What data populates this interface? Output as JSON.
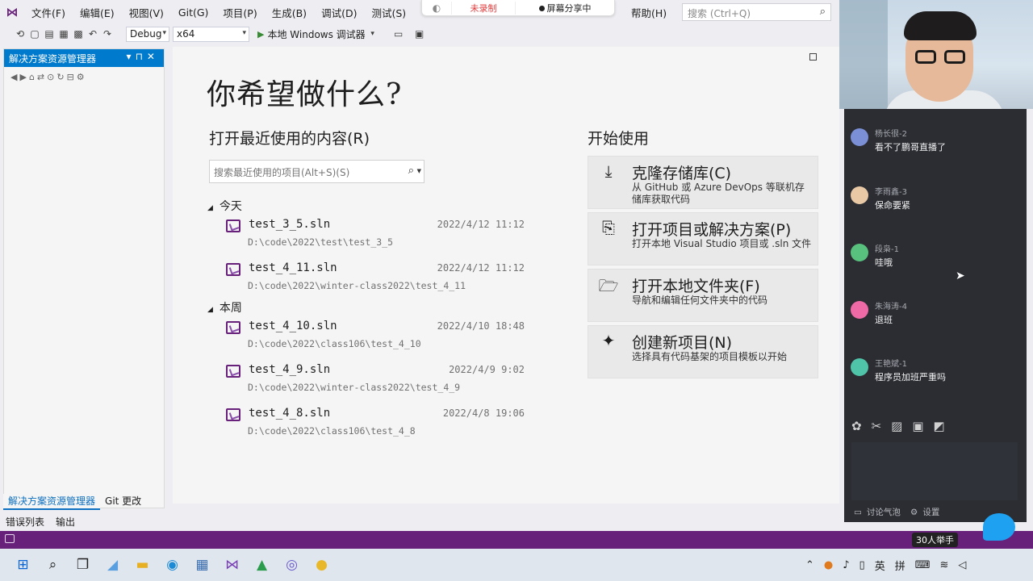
{
  "menu": {
    "items": [
      "文件(F)",
      "编辑(E)",
      "视图(V)",
      "Git(G)",
      "项目(P)",
      "生成(B)",
      "调试(D)",
      "测试(S)"
    ],
    "help": "帮助(H)",
    "search_placeholder": "搜索 (Ctrl+Q)"
  },
  "recording": {
    "unrecorded": "未录制",
    "sharing": "屏幕分享中"
  },
  "toolbar": {
    "config": "Debug",
    "platform": "x64",
    "run_target": "本地 Windows 调试器"
  },
  "solution_explorer": {
    "title": "解决方案资源管理器",
    "tabs": [
      "解决方案资源管理器",
      "Git 更改"
    ]
  },
  "bottom_tabs": [
    "错误列表",
    "输出"
  ],
  "start_page": {
    "title": "你希望做什么?",
    "recent_heading": "打开最近使用的内容(R)",
    "recent_search_placeholder": "搜索最近使用的项目(Alt+S)(S)",
    "groups": [
      {
        "label": "今天",
        "items": [
          {
            "name": "test_3_5.sln",
            "date": "2022/4/12 11:12",
            "path": "D:\\code\\2022\\test\\test_3_5"
          },
          {
            "name": "test_4_11.sln",
            "date": "2022/4/12 11:12",
            "path": "D:\\code\\2022\\winter-class2022\\test_4_11"
          }
        ]
      },
      {
        "label": "本周",
        "items": [
          {
            "name": "test_4_10.sln",
            "date": "2022/4/10 18:48",
            "path": "D:\\code\\2022\\class106\\test_4_10"
          },
          {
            "name": "test_4_9.sln",
            "date": "2022/4/9 9:02",
            "path": "D:\\code\\2022\\winter-class2022\\test_4_9"
          },
          {
            "name": "test_4_8.sln",
            "date": "2022/4/8 19:06",
            "path": "D:\\code\\2022\\class106\\test_4_8"
          }
        ]
      }
    ],
    "get_started_heading": "开始使用",
    "cards": [
      {
        "title": "克隆存储库(C)",
        "desc": "从 GitHub 或 Azure DevOps 等联机存储库获取代码",
        "icon": "clone-icon"
      },
      {
        "title": "打开项目或解决方案(P)",
        "desc": "打开本地 Visual Studio 项目或 .sln 文件",
        "icon": "open-project-icon"
      },
      {
        "title": "打开本地文件夹(F)",
        "desc": "导航和编辑任何文件夹中的代码",
        "icon": "open-folder-icon"
      },
      {
        "title": "创建新项目(N)",
        "desc": "选择具有代码基架的项目模板以开始",
        "icon": "new-project-icon"
      }
    ]
  },
  "chat": {
    "messages": [
      {
        "user": "杨长很-2",
        "text": "看不了鹏哥直播了",
        "color": "#7b8fd6"
      },
      {
        "user": "李雨鑫-3",
        "text": "保命要紧",
        "color": "#e9c9a5"
      },
      {
        "user": "段枭-1",
        "text": "哇哦",
        "color": "#59c17e"
      },
      {
        "user": "朱海涛-4",
        "text": "退班",
        "color": "#ee6aa6"
      },
      {
        "user": "王艳斌-1",
        "text": "程序员加班严重吗",
        "color": "#4fc4a8"
      }
    ],
    "footer_bubble": "讨论气泡",
    "footer_settings": "设置"
  },
  "meeting": {
    "hands_raised": "30人举手"
  },
  "tray": {
    "ime_lang": "英",
    "ime_mode": "拼"
  }
}
